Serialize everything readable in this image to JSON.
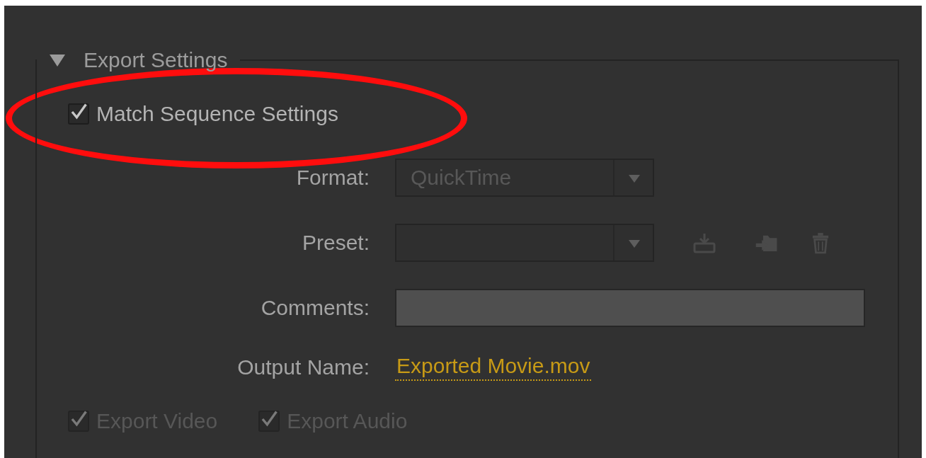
{
  "section": {
    "title": "Export Settings",
    "expanded": true
  },
  "match_sequence": {
    "label": "Match Sequence Settings",
    "checked": true
  },
  "fields": [
    {
      "kind": "dropdown",
      "label": "Format:",
      "value": "QuickTime",
      "disabled": true
    },
    {
      "kind": "dropdown",
      "label": "Preset:",
      "actions": true
    },
    {
      "kind": "text",
      "label": "Comments:"
    },
    {
      "kind": "link",
      "label": "Output Name:",
      "value": "Exported Movie.mov"
    }
  ],
  "exports": [
    {
      "label": "Export Video",
      "checked": true,
      "disabled": true
    },
    {
      "label": "Export Audio",
      "checked": true,
      "disabled": true
    }
  ]
}
